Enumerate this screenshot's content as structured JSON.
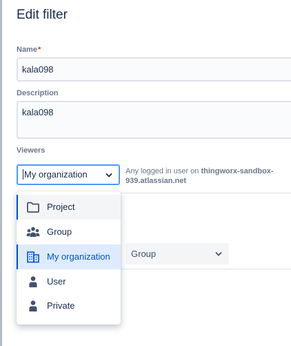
{
  "dialog": {
    "title": "Edit filter"
  },
  "name_field": {
    "label": "Name",
    "required_mark": "*",
    "value": "kala098"
  },
  "description_field": {
    "label": "Description",
    "value": "kala098"
  },
  "viewers": {
    "label": "Viewers",
    "selected_value": "My organization",
    "info_prefix": "Any logged in user on ",
    "info_site": "thingworx-sandbox-939.atlassian.net"
  },
  "editors_group_select": {
    "value": "Group"
  },
  "viewer_menu": {
    "items": [
      {
        "label": "Project",
        "icon": "folder-icon",
        "state": "hovered"
      },
      {
        "label": "Group",
        "icon": "people-group-icon",
        "state": "normal"
      },
      {
        "label": "My organization",
        "icon": "office-building-icon",
        "state": "selected"
      },
      {
        "label": "User",
        "icon": "person-icon",
        "state": "normal"
      },
      {
        "label": "Private",
        "icon": "person-icon",
        "state": "normal"
      }
    ]
  },
  "colors": {
    "accent": "#0052cc",
    "selected_bg": "#deebff",
    "focus_border": "#4c9aff",
    "required": "#de350b"
  }
}
